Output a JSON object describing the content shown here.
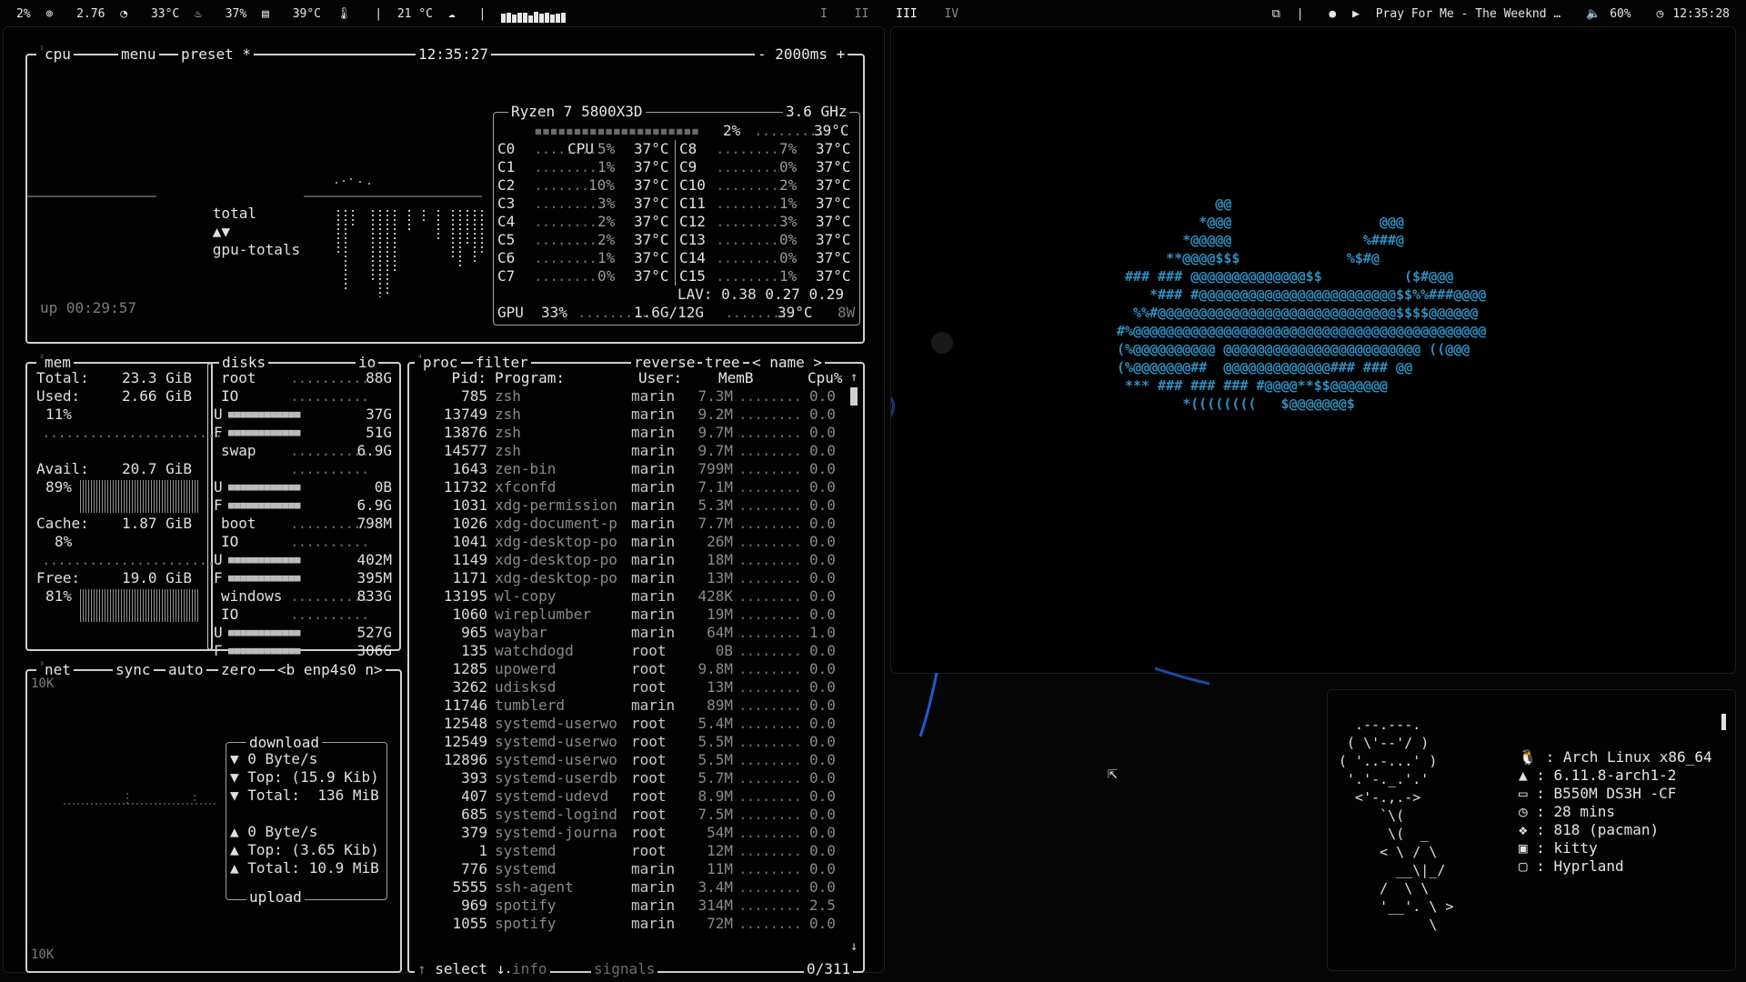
{
  "topbar": {
    "cpu": "2%",
    "load": "2.76",
    "cpu_temp": "33°C",
    "mem": "37%",
    "gpu_temp": "39°C",
    "outside_temp": "21 °C",
    "workspaces": [
      "I",
      "II",
      "III",
      "IV"
    ],
    "active_workspace": "III",
    "media": "Pray For Me - The Weeknd …",
    "volume": "60%",
    "clock": "12:35:28"
  },
  "cpu_box": {
    "title": "cpu",
    "menu": "menu",
    "preset": "preset *",
    "time": "12:35:27",
    "interval": "2000ms",
    "graph_label": "total",
    "gpu_label": "gpu-totals",
    "uptime": "up 00:29:57",
    "model": "Ryzen 7 5800X3D",
    "freq": "3.6 GHz",
    "cpu_row": {
      "label": "CPU",
      "pct": "2%",
      "temp": "39°C"
    },
    "cores_left": [
      {
        "name": "C0",
        "pct": "5%",
        "temp": "37°C"
      },
      {
        "name": "C1",
        "pct": "1%",
        "temp": "37°C"
      },
      {
        "name": "C2",
        "pct": "10%",
        "temp": "37°C"
      },
      {
        "name": "C3",
        "pct": "3%",
        "temp": "37°C"
      },
      {
        "name": "C4",
        "pct": "2%",
        "temp": "37°C"
      },
      {
        "name": "C5",
        "pct": "2%",
        "temp": "37°C"
      },
      {
        "name": "C6",
        "pct": "1%",
        "temp": "37°C"
      },
      {
        "name": "C7",
        "pct": "0%",
        "temp": "37°C"
      }
    ],
    "cores_right": [
      {
        "name": "C8",
        "pct": "7%",
        "temp": "37°C"
      },
      {
        "name": "C9",
        "pct": "0%",
        "temp": "37°C"
      },
      {
        "name": "C10",
        "pct": "2%",
        "temp": "37°C"
      },
      {
        "name": "C11",
        "pct": "1%",
        "temp": "37°C"
      },
      {
        "name": "C12",
        "pct": "3%",
        "temp": "37°C"
      },
      {
        "name": "C13",
        "pct": "0%",
        "temp": "37°C"
      },
      {
        "name": "C14",
        "pct": "0%",
        "temp": "37°C"
      },
      {
        "name": "C15",
        "pct": "1%",
        "temp": "37°C"
      }
    ],
    "lav": "LAV: 0.38 0.27 0.29",
    "gpu_row": {
      "label": "GPU",
      "pct": "33%",
      "mem": "1.6G/12G",
      "temp": "39°C",
      "power": "8W"
    }
  },
  "mem_box": {
    "title": "mem",
    "total_label": "Total:",
    "total": "23.3 GiB",
    "used_label": "Used:",
    "used": "2.66 GiB",
    "used_pct": "11%",
    "avail_label": "Avail:",
    "avail": "20.7 GiB",
    "avail_pct": "89%",
    "cache_label": "Cache:",
    "cache": "1.87 GiB",
    "cache_pct": "8%",
    "free_label": "Free:",
    "free": "19.0 GiB",
    "free_pct": "81%"
  },
  "disks_box": {
    "title": "disks",
    "io": "io",
    "disks": [
      {
        "name": "root",
        "size": "88G",
        "io": "IO",
        "used": "37G",
        "free": "51G"
      },
      {
        "name": "swap",
        "size": "6.9G",
        "io": "",
        "used": "0B",
        "free": "6.9G"
      },
      {
        "name": "boot",
        "size": "798M",
        "io": "IO",
        "used": "402M",
        "free": "395M"
      },
      {
        "name": "windows",
        "size": "833G",
        "io": "IO",
        "used": "527G",
        "free": "306G"
      }
    ]
  },
  "net_box": {
    "title": "net",
    "sync": "sync",
    "auto": "auto",
    "zero": "zero",
    "iface_prev": "<b",
    "iface": "enp4s0",
    "iface_next": "n>",
    "scale_top": "10K",
    "scale_bottom": "10K",
    "download_label": "download",
    "dl_rate": "0 Byte/s",
    "dl_top": "Top: (15.9 Kib)",
    "dl_total": "Total:  136 MiB",
    "ul_rate": "0 Byte/s",
    "ul_top": "Top: (3.65 Kib)",
    "ul_total": "Total: 10.9 MiB",
    "upload_label": "upload"
  },
  "proc_box": {
    "title": "proc",
    "filter": "filter",
    "reverse": "reverse",
    "tree": "tree",
    "sort": "name",
    "headers": {
      "pid": "Pid:",
      "program": "Program:",
      "user": "User:",
      "mem": "MemB",
      "cpu": "Cpu%"
    },
    "rows": [
      [
        "785",
        "zsh",
        "marin",
        "7.3M",
        "0.0"
      ],
      [
        "13749",
        "zsh",
        "marin",
        "9.2M",
        "0.0"
      ],
      [
        "13876",
        "zsh",
        "marin",
        "9.7M",
        "0.0"
      ],
      [
        "14577",
        "zsh",
        "marin",
        "9.7M",
        "0.0"
      ],
      [
        "1643",
        "zen-bin",
        "marin",
        "799M",
        "0.0"
      ],
      [
        "11732",
        "xfconfd",
        "marin",
        "7.1M",
        "0.0"
      ],
      [
        "1031",
        "xdg-permission",
        "marin",
        "5.3M",
        "0.0"
      ],
      [
        "1026",
        "xdg-document-p",
        "marin",
        "7.7M",
        "0.0"
      ],
      [
        "1041",
        "xdg-desktop-po",
        "marin",
        "26M",
        "0.0"
      ],
      [
        "1149",
        "xdg-desktop-po",
        "marin",
        "18M",
        "0.0"
      ],
      [
        "1171",
        "xdg-desktop-po",
        "marin",
        "13M",
        "0.0"
      ],
      [
        "13195",
        "wl-copy",
        "marin",
        "428K",
        "0.0"
      ],
      [
        "1060",
        "wireplumber",
        "marin",
        "19M",
        "0.0"
      ],
      [
        "965",
        "waybar",
        "marin",
        "64M",
        "1.0"
      ],
      [
        "135",
        "watchdogd",
        "root",
        "0B",
        "0.0"
      ],
      [
        "1285",
        "upowerd",
        "root",
        "9.8M",
        "0.0"
      ],
      [
        "3262",
        "udisksd",
        "root",
        "13M",
        "0.0"
      ],
      [
        "11746",
        "tumblerd",
        "marin",
        "89M",
        "0.0"
      ],
      [
        "12548",
        "systemd-userwo",
        "root",
        "5.4M",
        "0.0"
      ],
      [
        "12549",
        "systemd-userwo",
        "root",
        "5.5M",
        "0.0"
      ],
      [
        "12896",
        "systemd-userwo",
        "root",
        "5.5M",
        "0.0"
      ],
      [
        "393",
        "systemd-userdb",
        "root",
        "5.7M",
        "0.0"
      ],
      [
        "407",
        "systemd-udevd",
        "root",
        "8.9M",
        "0.0"
      ],
      [
        "685",
        "systemd-logind",
        "root",
        "7.5M",
        "0.0"
      ],
      [
        "379",
        "systemd-journa",
        "root",
        "54M",
        "0.0"
      ],
      [
        "1",
        "systemd",
        "root",
        "12M",
        "0.0"
      ],
      [
        "776",
        "systemd",
        "marin",
        "11M",
        "0.0"
      ],
      [
        "5555",
        "ssh-agent",
        "marin",
        "3.4M",
        "0.0"
      ],
      [
        "969",
        "spotify",
        "marin",
        "314M",
        "2.5"
      ],
      [
        "1055",
        "spotify",
        "marin",
        "72M",
        "0.0"
      ]
    ],
    "footer_select": "select",
    "footer_info": "info",
    "footer_signals": "signals",
    "count": "0/311"
  },
  "art": {
    "lines": [
      "            @@",
      "          *@@@                  @@@",
      "        *@@@@@                %###@",
      "      **@@@@$$$             %$#@",
      " ### ### @@@@@@@@@@@@@@$$          ($#@@@",
      "    *### #@@@@@@@@@@@@@@@@@@@@@@@@$$%%###@@@@",
      "  %%#@@@@@@@@@@@@@@@@@@@@@@@@@@@@@$$$$@@@@@@",
      "#%@@@@@@@@@@@@@@@@@@@@@@@@@@@@@@@@@@@@@@@@@@@",
      "(%@@@@@@@@@@ @@@@@@@@@@@@@@@@@@@@@@@@ ((@@@",
      "(%@@@@@@@##  @@@@@@@@@@@@@### ### @@",
      " *** ### ### ### #@@@@**$$@@@@@@@",
      "        *((((((((   $@@@@@@@$"
    ],
    "accent": "#2e8fc0",
    "red_part": "*((((((((("
  },
  "fetch": {
    "logo": [
      "  .--.---.",
      " ( \\'--'/ )",
      "( '..-...' )",
      " '.'-._.'.'",
      "  <'-.,.->",
      "     `\\(",
      "      \\(  _",
      "     < \\ / \\",
      "       __\\|_/",
      "     /  \\ \\",
      "     '__'. \\ >",
      "           \\"
    ],
    "items": [
      {
        "icon": "tux-icon",
        "glyph": "🐧",
        "value": ": Arch Linux x86_64"
      },
      {
        "icon": "kernel-icon",
        "glyph": "▲",
        "value": ": 6.11.8-arch1-2"
      },
      {
        "icon": "laptop-icon",
        "glyph": "▭",
        "value": ": B550M DS3H -CF"
      },
      {
        "icon": "clock-icon",
        "glyph": "◷",
        "value": ": 28 mins"
      },
      {
        "icon": "package-icon",
        "glyph": "❖",
        "value": ": 818 (pacman)"
      },
      {
        "icon": "terminal-icon",
        "glyph": "▣",
        "value": ": kitty"
      },
      {
        "icon": "window-icon",
        "glyph": "▢",
        "value": ": Hyprland"
      }
    ]
  }
}
